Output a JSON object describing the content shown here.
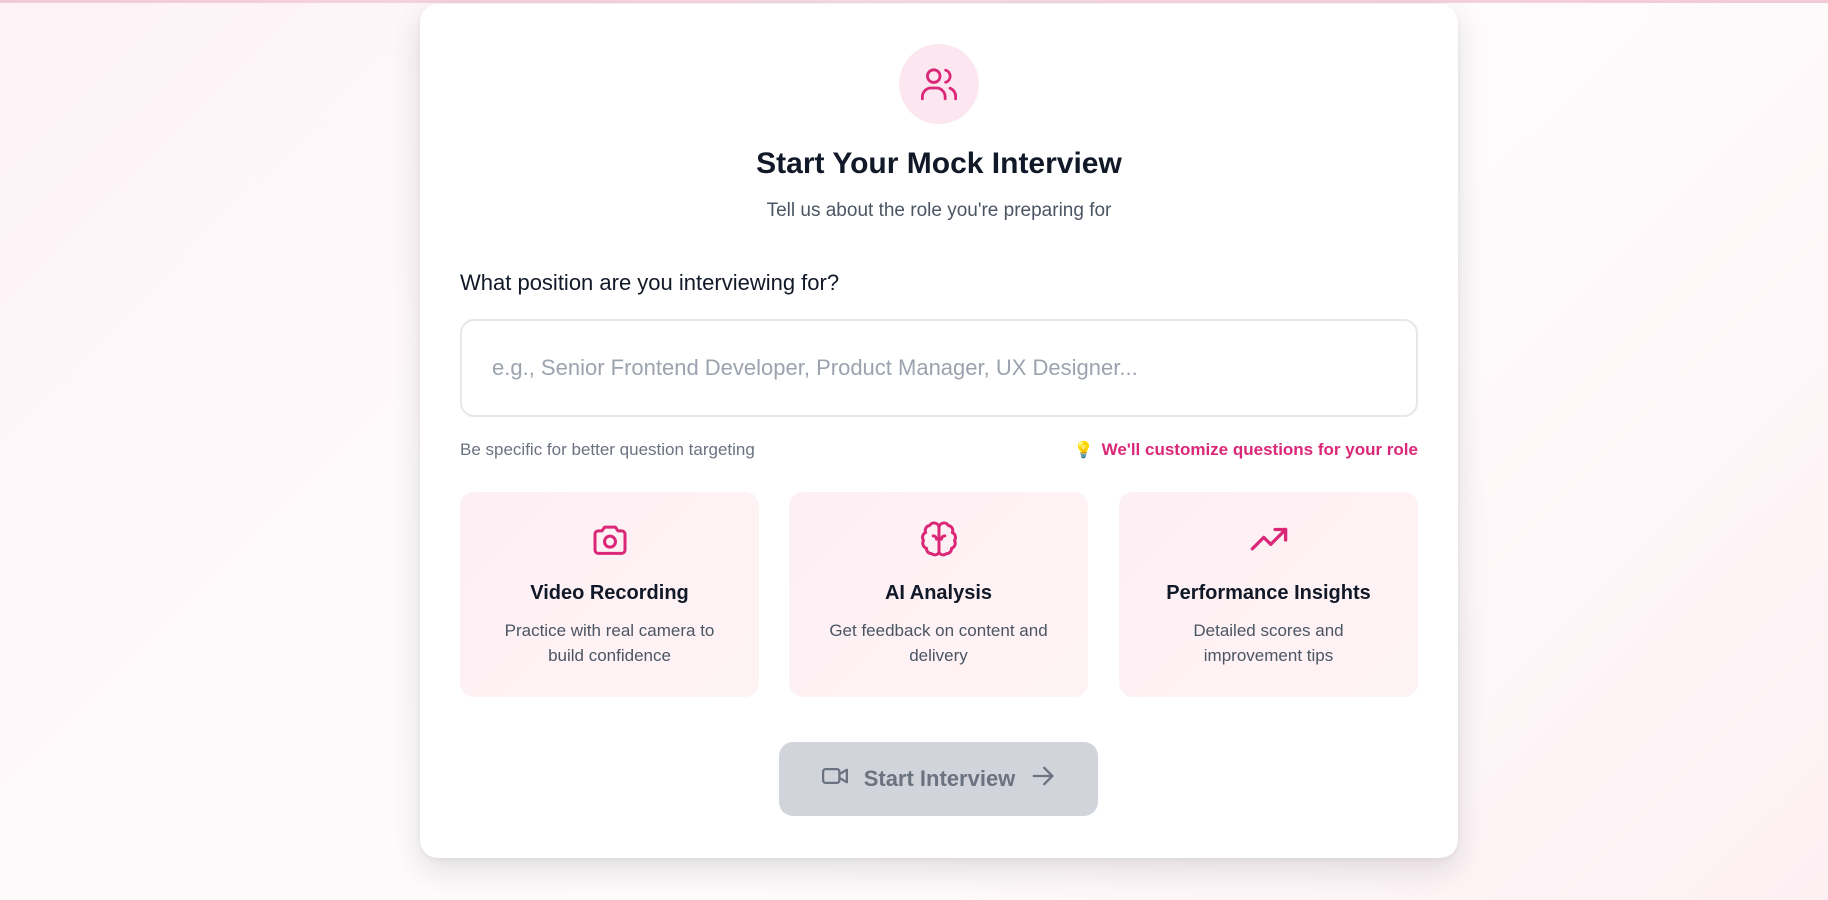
{
  "colors": {
    "accent": "#db2777",
    "accent_soft": "#fce7f0",
    "button_disabled_bg": "#d1d5db",
    "button_disabled_text": "#6b7280"
  },
  "header": {
    "icon": "users-icon",
    "title": "Start Your Mock Interview",
    "subtitle": "Tell us about the role you're preparing for"
  },
  "form": {
    "label": "What position are you interviewing for?",
    "value": "",
    "placeholder": "e.g., Senior Frontend Developer, Product Manager, UX Designer...",
    "hint_left": "Be specific for better question targeting",
    "hint_right_icon": "lightbulb-icon",
    "hint_right": "We'll customize questions for your role"
  },
  "features": [
    {
      "icon": "camera-icon",
      "title": "Video Recording",
      "description": "Practice with real camera to build confidence"
    },
    {
      "icon": "brain-icon",
      "title": "AI Analysis",
      "description": "Get feedback on content and delivery"
    },
    {
      "icon": "trending-up-icon",
      "title": "Performance Insights",
      "description": "Detailed scores and improvement tips"
    }
  ],
  "start_button": {
    "label": "Start Interview",
    "left_icon": "video-icon",
    "right_icon": "arrow-right-icon",
    "disabled": true
  }
}
